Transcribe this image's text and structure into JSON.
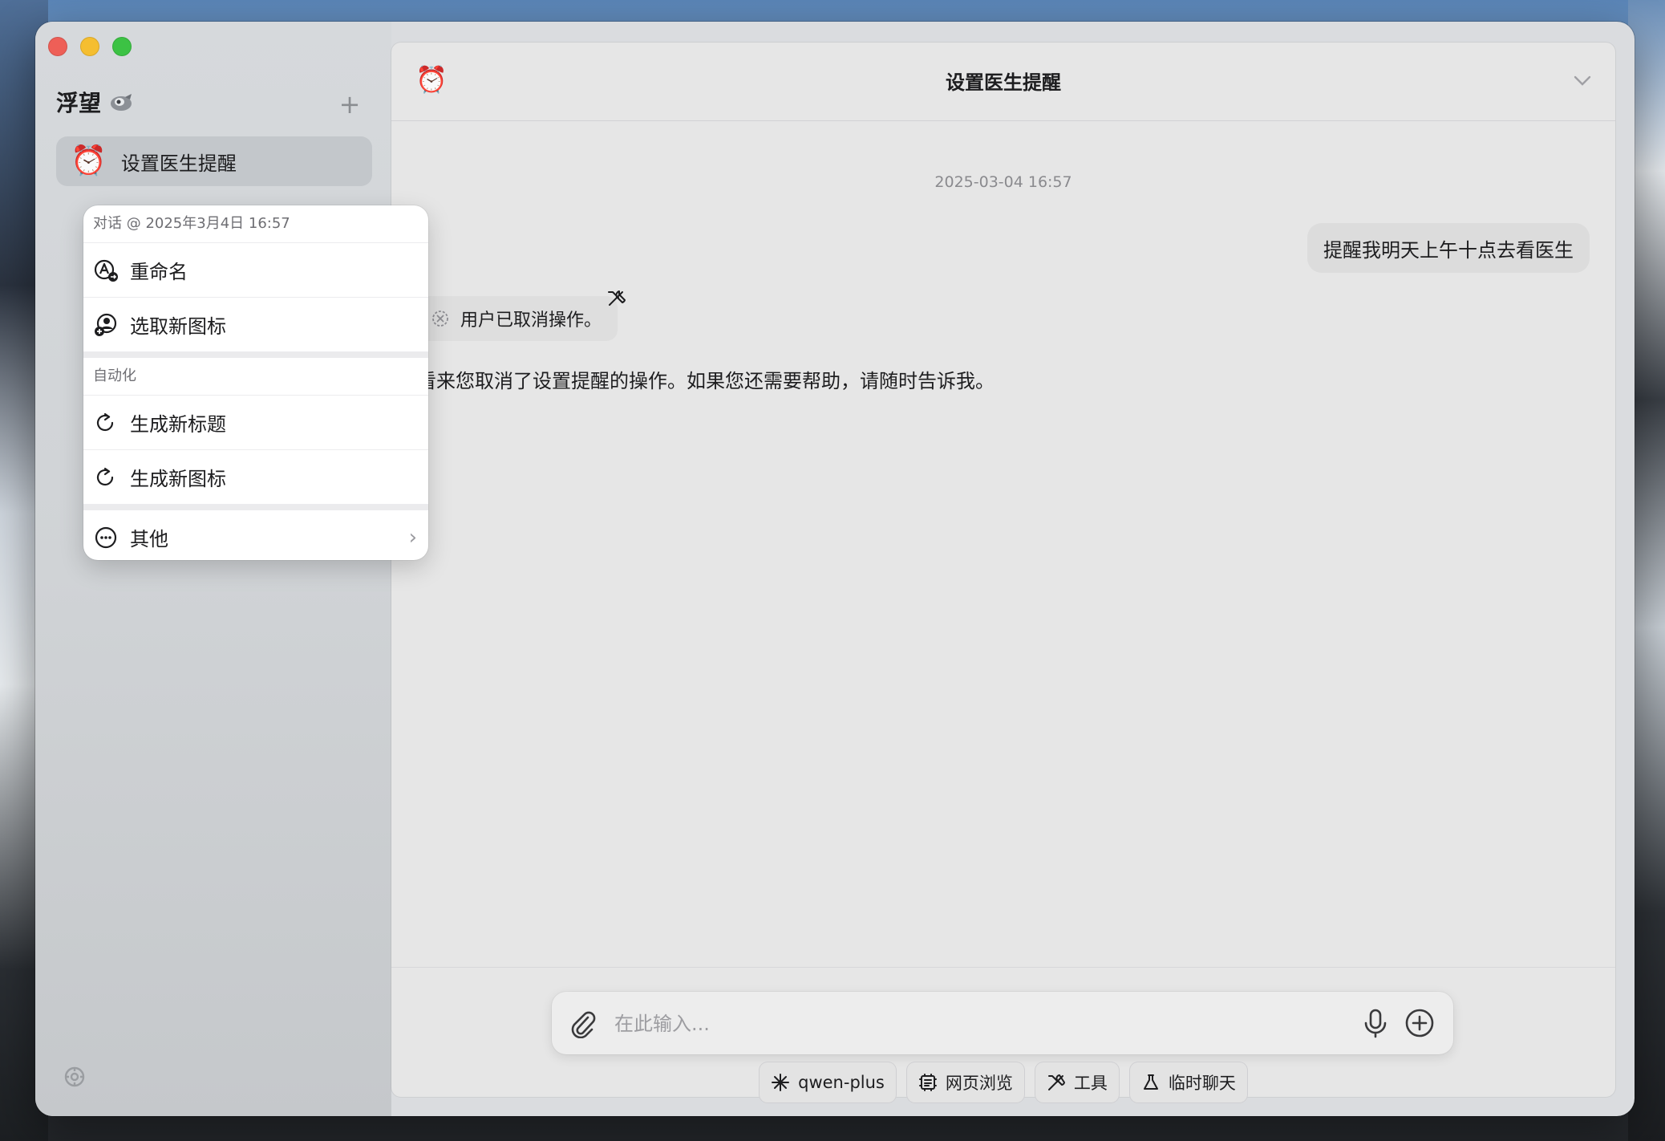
{
  "app": {
    "name": "浮望"
  },
  "sidebar": {
    "conversations": [
      {
        "emoji": "⏰",
        "title": "设置医生提醒",
        "selected": true
      }
    ]
  },
  "context_menu": {
    "header": "对话 @ 2025年3月4日 16:57",
    "items": [
      {
        "icon": "rename-icon",
        "label": "重命名"
      },
      {
        "icon": "pick-icon-icon",
        "label": "选取新图标"
      }
    ],
    "automation_header": "自动化",
    "automation_items": [
      {
        "icon": "refresh-icon",
        "label": "生成新标题"
      },
      {
        "icon": "refresh-icon",
        "label": "生成新图标"
      }
    ],
    "other": {
      "icon": "more-icon",
      "label": "其他"
    }
  },
  "chat": {
    "header_emoji": "⏰",
    "title": "设置医生提醒",
    "timestamp": "2025-03-04 16:57",
    "user_message": "提醒我明天上午十点去看医生",
    "tool_status": "用户已取消操作。",
    "assistant_message": "看来您取消了设置提醒的操作。如果您还需要帮助，请随时告诉我。"
  },
  "input": {
    "placeholder": "在此输入..."
  },
  "chips": [
    {
      "icon": "sparkle-icon",
      "label": "qwen-plus"
    },
    {
      "icon": "web-browse-icon",
      "label": "网页浏览"
    },
    {
      "icon": "tools-icon",
      "label": "工具"
    },
    {
      "icon": "flask-icon",
      "label": "临时聊天"
    }
  ]
}
